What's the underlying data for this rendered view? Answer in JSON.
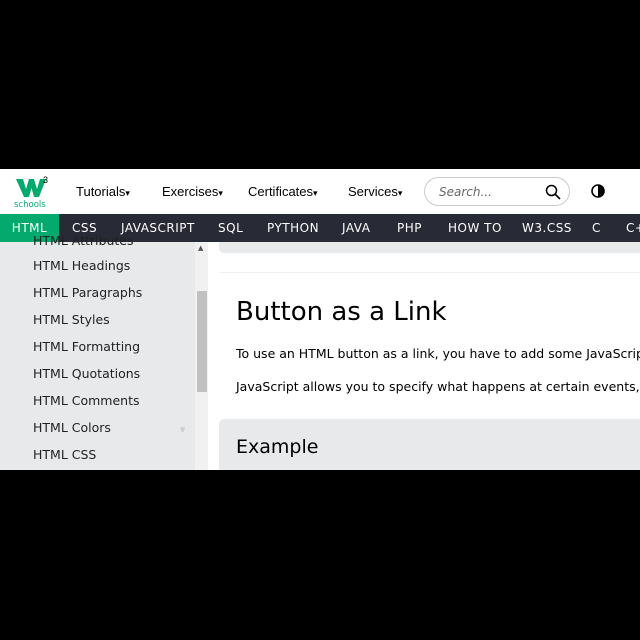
{
  "header": {
    "logo_text": "w3schools",
    "menu": [
      {
        "label": "Tutorials"
      },
      {
        "label": "Exercises"
      },
      {
        "label": "Certificates"
      },
      {
        "label": "Services"
      }
    ],
    "search_placeholder": "Search...",
    "caret": "▾"
  },
  "nav": {
    "tabs": [
      {
        "label": "HTML",
        "active": true
      },
      {
        "label": "CSS"
      },
      {
        "label": "JAVASCRIPT"
      },
      {
        "label": "SQL"
      },
      {
        "label": "PYTHON"
      },
      {
        "label": "JAVA"
      },
      {
        "label": "PHP"
      },
      {
        "label": "HOW TO"
      },
      {
        "label": "W3.CSS"
      },
      {
        "label": "C"
      },
      {
        "label": "C++"
      }
    ]
  },
  "sidebar": {
    "items": [
      {
        "label": "HTML Attributes"
      },
      {
        "label": "HTML Headings"
      },
      {
        "label": "HTML Paragraphs"
      },
      {
        "label": "HTML Styles"
      },
      {
        "label": "HTML Formatting"
      },
      {
        "label": "HTML Quotations"
      },
      {
        "label": "HTML Comments"
      },
      {
        "label": "HTML Colors"
      },
      {
        "label": "HTML CSS"
      }
    ]
  },
  "main": {
    "title": "Button as a Link",
    "paragraphs": [
      "To use an HTML button as a link, you have to add some JavaScript code.",
      "JavaScript allows you to specify what happens at certain events, such as a click of a button:"
    ],
    "example_title": "Example"
  },
  "colors": {
    "accent": "#04AA6D",
    "nav_bg": "#282A35",
    "sidebar_bg": "#E7E9EB"
  }
}
